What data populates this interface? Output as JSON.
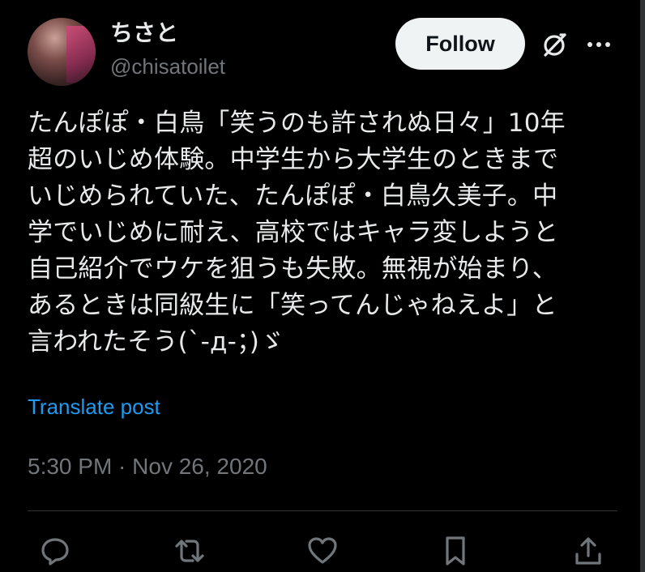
{
  "author": {
    "display_name": "ちさと",
    "handle": "@chisatoilet"
  },
  "header": {
    "follow_label": "Follow",
    "grok_icon": "grok-icon",
    "more_icon": "more-horizontal-icon"
  },
  "tweet": {
    "text": "たんぽぽ・白鳥「笑うのも許されぬ日々」10年\n超のいじめ体験。中学生から大学生のときまで\nいじめられていた、たんぽぽ・白鳥久美子。中\n学でいじめに耐え、高校ではキャラ変しようと\n自己紹介でウケを狙うも失敗。無視が始まり、\nあるときは同級生に「笑ってんじゃねえよ」と\n言われたそう(`-д-；)ゞ",
    "translate_label": "Translate post",
    "timestamp": "5:30 PM · Nov 26, 2020"
  },
  "actions": {
    "reply_icon": "reply-icon",
    "retweet_icon": "retweet-icon",
    "like_icon": "heart-icon",
    "bookmark_icon": "bookmark-icon",
    "share_icon": "share-icon"
  },
  "colors": {
    "background": "#000000",
    "text": "#e7e9ea",
    "secondary": "#71767b",
    "link": "#1d9bf0",
    "button_bg": "#eff3f4",
    "border": "#2f3336"
  }
}
